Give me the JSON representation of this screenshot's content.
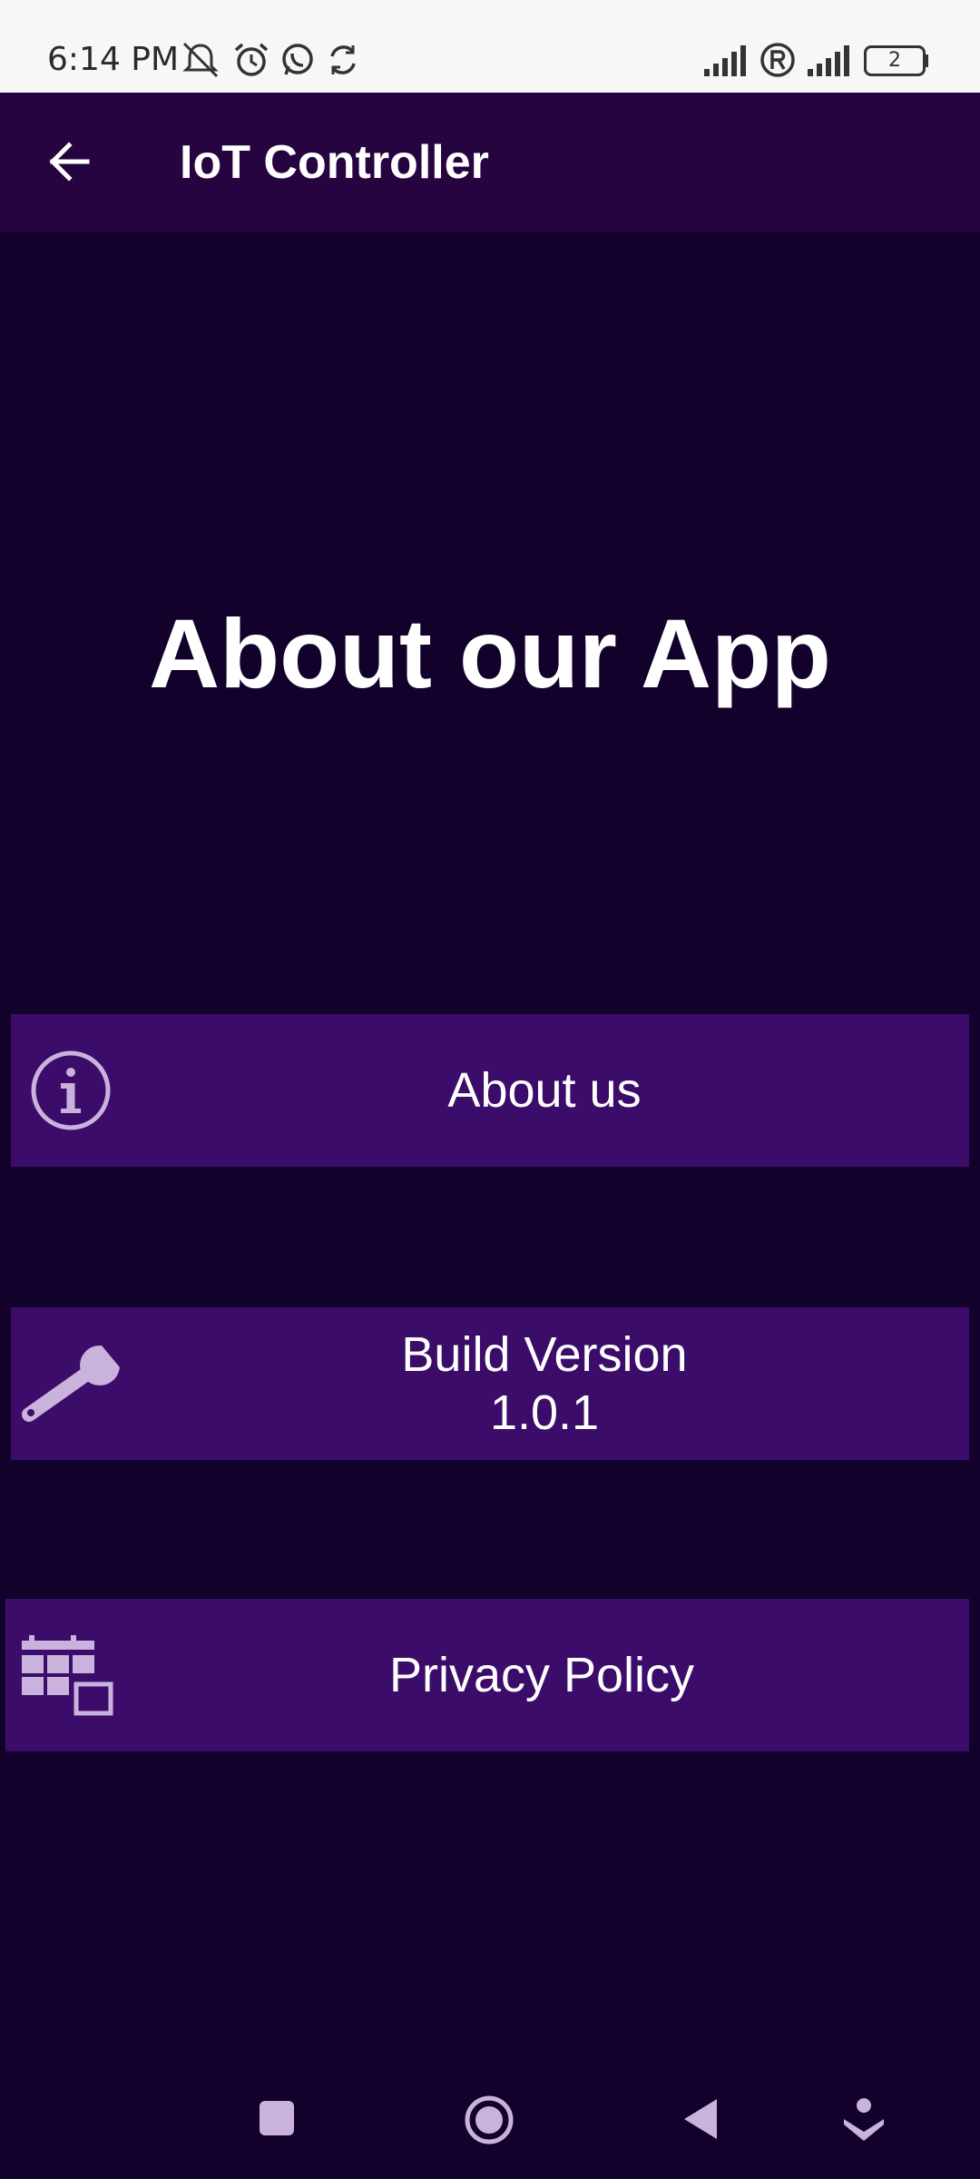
{
  "status_bar": {
    "time": "6:14 PM",
    "battery_level": "2"
  },
  "app_bar": {
    "title": "IoT Controller"
  },
  "main": {
    "heading": "About our App",
    "items": [
      {
        "label": "About us",
        "icon": "info-icon"
      },
      {
        "label": "Build Version",
        "sublabel": "1.0.1",
        "icon": "wrench-icon"
      },
      {
        "label": "Privacy Policy",
        "icon": "calendar-icon"
      }
    ]
  },
  "colors": {
    "background": "#12022b",
    "app_bar": "#25043f",
    "card": "#3c0c6b",
    "icon": "#c9b3dd"
  }
}
